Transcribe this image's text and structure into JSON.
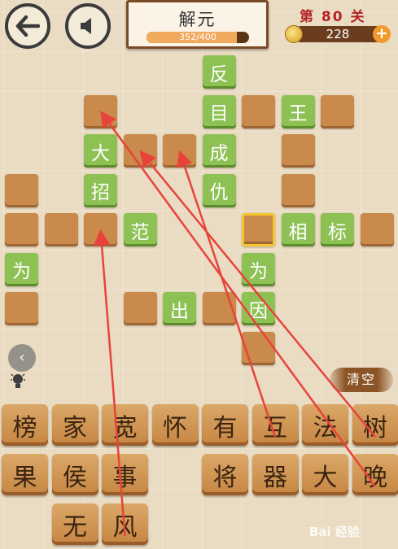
{
  "header": {
    "title": "解元",
    "progress_text": "352/400",
    "progress_fraction": 0.88,
    "level_text": "第 80 关",
    "coins": "228",
    "add_label": "+"
  },
  "board": {
    "cells": [
      {
        "col": 5,
        "row": 0,
        "char": "反"
      },
      {
        "col": 2,
        "row": 1,
        "char": ""
      },
      {
        "col": 5,
        "row": 1,
        "char": "目"
      },
      {
        "col": 6,
        "row": 1,
        "char": ""
      },
      {
        "col": 7,
        "row": 1,
        "char": "王"
      },
      {
        "col": 8,
        "row": 1,
        "char": ""
      },
      {
        "col": 2,
        "row": 2,
        "char": "大"
      },
      {
        "col": 3,
        "row": 2,
        "char": ""
      },
      {
        "col": 4,
        "row": 2,
        "char": ""
      },
      {
        "col": 5,
        "row": 2,
        "char": "成"
      },
      {
        "col": 7,
        "row": 2,
        "char": ""
      },
      {
        "col": 0,
        "row": 3,
        "char": ""
      },
      {
        "col": 2,
        "row": 3,
        "char": "招"
      },
      {
        "col": 5,
        "row": 3,
        "char": "仇"
      },
      {
        "col": 7,
        "row": 3,
        "char": ""
      },
      {
        "col": 0,
        "row": 4,
        "char": ""
      },
      {
        "col": 1,
        "row": 4,
        "char": ""
      },
      {
        "col": 2,
        "row": 4,
        "char": ""
      },
      {
        "col": 3,
        "row": 4,
        "char": "范"
      },
      {
        "col": 6,
        "row": 4,
        "char": "",
        "selected": true
      },
      {
        "col": 7,
        "row": 4,
        "char": "相"
      },
      {
        "col": 8,
        "row": 4,
        "char": "标"
      },
      {
        "col": 9,
        "row": 4,
        "char": ""
      },
      {
        "col": 0,
        "row": 5,
        "char": "为"
      },
      {
        "col": 6,
        "row": 5,
        "char": "为"
      },
      {
        "col": 0,
        "row": 6,
        "char": ""
      },
      {
        "col": 3,
        "row": 6,
        "char": ""
      },
      {
        "col": 4,
        "row": 6,
        "char": "出"
      },
      {
        "col": 5,
        "row": 6,
        "char": ""
      },
      {
        "col": 6,
        "row": 6,
        "char": "因"
      },
      {
        "col": 6,
        "row": 7,
        "char": ""
      }
    ]
  },
  "clear_label": "清空",
  "side_arrow_label": "‹",
  "tiles": [
    {
      "row": 0,
      "col": 0,
      "char": "榜"
    },
    {
      "row": 0,
      "col": 1,
      "char": "家"
    },
    {
      "row": 0,
      "col": 2,
      "char": "宽"
    },
    {
      "row": 0,
      "col": 3,
      "char": "怀"
    },
    {
      "row": 0,
      "col": 4,
      "char": "有"
    },
    {
      "row": 0,
      "col": 5,
      "char": "互"
    },
    {
      "row": 0,
      "col": 6,
      "char": "法"
    },
    {
      "row": 0,
      "col": 7,
      "char": "树"
    },
    {
      "row": 1,
      "col": 0,
      "char": "果"
    },
    {
      "row": 1,
      "col": 1,
      "char": "侯"
    },
    {
      "row": 1,
      "col": 2,
      "char": "事"
    },
    {
      "row": 1,
      "col": 4,
      "char": "将"
    },
    {
      "row": 1,
      "col": 5,
      "char": "器"
    },
    {
      "row": 1,
      "col": 6,
      "char": "大"
    },
    {
      "row": 1,
      "col": 7,
      "char": "晚"
    },
    {
      "row": 2,
      "col": 1,
      "char": "无"
    },
    {
      "row": 2,
      "col": 2,
      "char": "风"
    }
  ],
  "annotation_arrows": [
    {
      "from_tile": "风",
      "to_cell": [
        2,
        4
      ]
    },
    {
      "from_tile": "互",
      "to_cell": [
        4,
        2
      ]
    },
    {
      "from_tile": "树",
      "to_cell": [
        3,
        2
      ]
    },
    {
      "from_tile": "晚",
      "to_cell": [
        2,
        1
      ]
    }
  ],
  "arrow_color": "#e8433a",
  "watermark": "Bai 经验"
}
